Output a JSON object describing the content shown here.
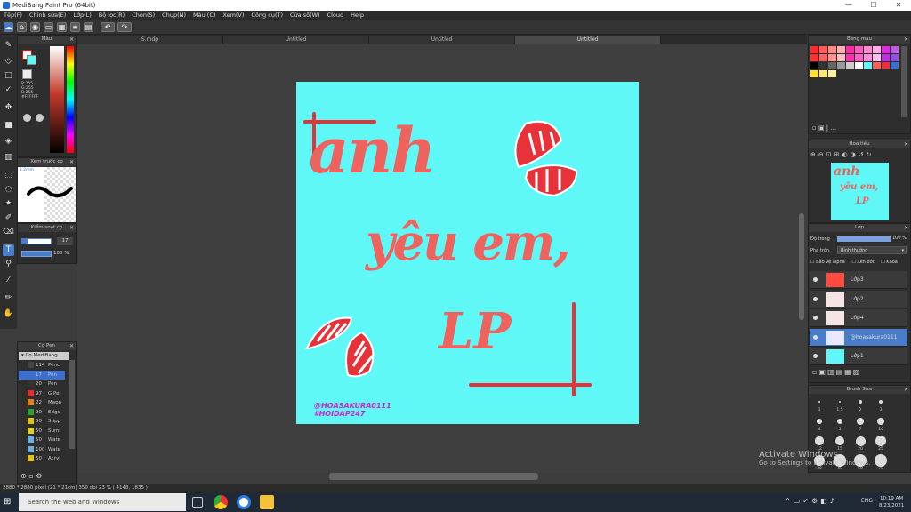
{
  "window": {
    "title": "MediBang Paint Pro (64bit)",
    "minimize": "—",
    "maximize": "☐",
    "close": "✕"
  },
  "menu": [
    "Tệp(F)",
    "Chỉnh sửa(E)",
    "Lớp(L)",
    "Bộ lọc(R)",
    "Chọn(S)",
    "Chụp(N)",
    "Màu (C)",
    "Xem(V)",
    "Công cụ(T)",
    "Cửa số(W)",
    "Cloud",
    "Help"
  ],
  "tabs": [
    "S.mdp",
    "Untitled",
    "Untitled",
    "Untitled"
  ],
  "color_panel": {
    "title": "Màu",
    "r": "R:255",
    "g": "G:255",
    "b": "B:255",
    "hex": "#FFFFFF"
  },
  "preview_panel": {
    "title": "Xem trước cọ",
    "size": "1.2mm"
  },
  "brush_control": {
    "title": "Kiểm soát cọ",
    "size": "17",
    "opacity": "100 %"
  },
  "brush_list": {
    "title": "Cọ Pen",
    "group": "Cọ MediBang",
    "items": [
      {
        "size": "114",
        "name": "Penc",
        "color": "#444444"
      },
      {
        "size": "17",
        "name": "Pen",
        "color": "#3a6fd0",
        "selected": true
      },
      {
        "size": "20",
        "name": "Pen",
        "color": "#333333"
      },
      {
        "size": "97",
        "name": "G Pe",
        "color": "#e03030"
      },
      {
        "size": "22",
        "name": "Mapp",
        "color": "#e08020"
      },
      {
        "size": "20",
        "name": "Edge",
        "color": "#30a030"
      },
      {
        "size": "50",
        "name": "Stipp",
        "color": "#e0c020"
      },
      {
        "size": "50",
        "name": "Sumi",
        "color": "#e0d030"
      },
      {
        "size": "50",
        "name": "Wate",
        "color": "#70b0e0"
      },
      {
        "size": "100",
        "name": "Wate",
        "color": "#70b0e0"
      },
      {
        "size": "50",
        "name": "Acryl",
        "color": "#e0c020"
      }
    ]
  },
  "palette_panel": {
    "title": "Bảng màu",
    "page": "..."
  },
  "navigator_panel": {
    "title": "Hoa tiêu"
  },
  "layer_panel": {
    "title": "Lớp",
    "opacity_label": "Độ trong",
    "opacity_value": "100 %",
    "blend_label": "Pha trộn",
    "blend_value": "Bình thường",
    "protect_alpha": "Bảo vệ alpha",
    "clipping": "Xén bớt",
    "lock": "Khóa",
    "layers": [
      {
        "name": "Lớp3",
        "thumb": "#ff4b3e",
        "selected": false
      },
      {
        "name": "Lớp2",
        "thumb": "#f4e4e4",
        "selected": false
      },
      {
        "name": "Lớp4",
        "thumb": "#f4e4e4",
        "selected": false
      },
      {
        "name": "@hoasakura0111",
        "thumb": "#e8e8ff",
        "selected": true
      },
      {
        "name": "Lớp1",
        "thumb": "#5ff8f7",
        "selected": false
      }
    ]
  },
  "brush_size_panel": {
    "title": "Brush Size",
    "sizes": [
      "1",
      "1.5",
      "2",
      "3",
      "4",
      "5",
      "7",
      "10",
      "12",
      "15",
      "20",
      "25",
      "30",
      "40",
      "50",
      "70"
    ]
  },
  "canvas": {
    "bg_color": "#5ff8f7",
    "line1": "anh",
    "line2": "yêu em,",
    "line3": "LP",
    "credit1": "@HOASAKURA0111",
    "credit2": "#HOIDAP247"
  },
  "status": {
    "text": "2880 * 2880 pixel  (21 * 21cm)  350 dpi  23 %  ( 4148, 1835 )"
  },
  "watermark": {
    "line1": "Activate Windows",
    "line2": "Go to Settings to activate Windows."
  },
  "taskbar": {
    "search_placeholder": "Search the web and Windows",
    "lang": "ENG",
    "time": "10:19 AM",
    "date": "8/23/2021"
  }
}
